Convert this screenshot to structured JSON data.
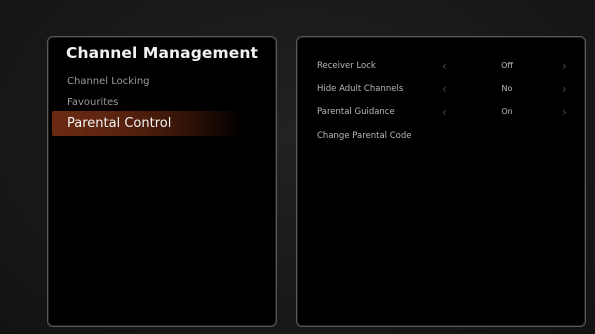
{
  "menu": {
    "title": "Channel Management",
    "items": [
      {
        "label": "Channel Locking"
      },
      {
        "label": "Favourites"
      },
      {
        "label": "Parental Control"
      }
    ]
  },
  "settings": [
    {
      "label": "Receiver Lock",
      "value": "Off",
      "left_arrow": "‹",
      "right_arrow": "›"
    },
    {
      "label": "Hide Adult Channels",
      "value": "No",
      "left_arrow": "‹",
      "right_arrow": "›"
    },
    {
      "label": "Parental Guidance",
      "value": "On",
      "left_arrow": "‹",
      "right_arrow": "›"
    },
    {
      "label": "Change Parental Code"
    }
  ],
  "colors": {
    "highlight": "#6b2a12",
    "panel_border": "#5a5a5a",
    "background": "#1b1b1b"
  }
}
